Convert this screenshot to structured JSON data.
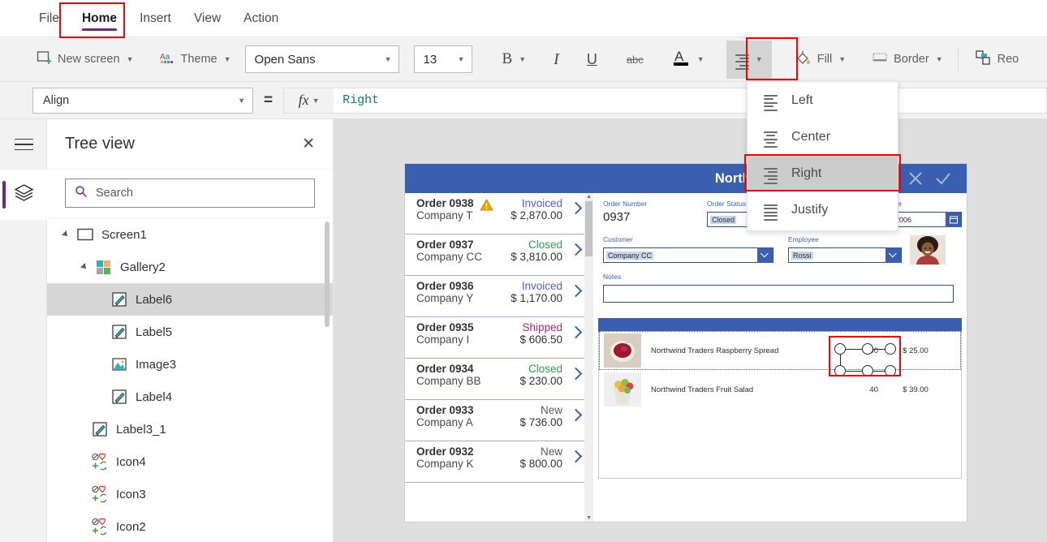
{
  "menubar": {
    "items": [
      {
        "label": "File",
        "active": false
      },
      {
        "label": "Home",
        "active": true
      },
      {
        "label": "Insert",
        "active": false
      },
      {
        "label": "View",
        "active": false
      },
      {
        "label": "Action",
        "active": false
      }
    ]
  },
  "ribbon": {
    "new_screen": "New screen",
    "theme": "Theme",
    "font_name": "Open Sans",
    "font_size": "13",
    "bold": "B",
    "italic": "I",
    "underline": "U",
    "strikethrough": "abc",
    "font_color": "A",
    "align": "align-icon",
    "fill": "Fill",
    "border": "Border",
    "reorder": "Reo"
  },
  "formula_bar": {
    "property": "Align",
    "equals": "=",
    "fx": "fx",
    "value": "Right"
  },
  "align_menu": {
    "items": [
      {
        "label": "Left",
        "selected": false
      },
      {
        "label": "Center",
        "selected": false
      },
      {
        "label": "Right",
        "selected": true
      },
      {
        "label": "Justify",
        "selected": false
      }
    ]
  },
  "tree_view": {
    "title": "Tree view",
    "close": "✕",
    "search_placeholder": "Search",
    "nodes": [
      {
        "label": "Screen1",
        "icon": "screen-icon",
        "indent": 0,
        "expander": true,
        "selected": false
      },
      {
        "label": "Gallery2",
        "icon": "gallery-icon",
        "indent": 1,
        "expander": true,
        "selected": false
      },
      {
        "label": "Label6",
        "icon": "label-icon",
        "indent": 2,
        "expander": false,
        "selected": true
      },
      {
        "label": "Label5",
        "icon": "label-icon",
        "indent": 2,
        "expander": false,
        "selected": false
      },
      {
        "label": "Image3",
        "icon": "image-icon",
        "indent": 2,
        "expander": false,
        "selected": false
      },
      {
        "label": "Label4",
        "icon": "label-icon",
        "indent": 2,
        "expander": false,
        "selected": false
      },
      {
        "label": "Label3_1",
        "icon": "label-icon",
        "indent": 1,
        "expander": false,
        "selected": false
      },
      {
        "label": "Icon4",
        "icon": "icon-icon",
        "indent": 1,
        "expander": false,
        "selected": false
      },
      {
        "label": "Icon3",
        "icon": "icon-icon",
        "indent": 1,
        "expander": false,
        "selected": false
      },
      {
        "label": "Icon2",
        "icon": "icon-icon",
        "indent": 1,
        "expander": false,
        "selected": false
      }
    ]
  },
  "app": {
    "gallery": {
      "rows": [
        {
          "order": "Order 0938",
          "company": "Company T",
          "status": "Invoiced",
          "status_color": "#5b5bd6",
          "amount": "$ 2,870.00",
          "warning": true
        },
        {
          "order": "Order 0937",
          "company": "Company CC",
          "status": "Closed",
          "status_color": "#2e9e4f",
          "amount": "$ 3,810.00",
          "warning": false
        },
        {
          "order": "Order 0936",
          "company": "Company Y",
          "status": "Invoiced",
          "status_color": "#5b5bd6",
          "amount": "$ 1,170.00",
          "warning": false
        },
        {
          "order": "Order 0935",
          "company": "Company I",
          "status": "Shipped",
          "status_color": "#b4247a",
          "amount": "$ 606.50",
          "warning": false
        },
        {
          "order": "Order 0934",
          "company": "Company BB",
          "status": "Closed",
          "status_color": "#2e9e4f",
          "amount": "$ 230.00",
          "warning": false
        },
        {
          "order": "Order 0933",
          "company": "Company A",
          "status": "New",
          "status_color": "#5a5a5a",
          "amount": "$ 736.00",
          "warning": false
        },
        {
          "order": "Order 0932",
          "company": "Company K",
          "status": "New",
          "status_color": "#5a5a5a",
          "amount": "$ 800.00",
          "warning": false
        }
      ]
    },
    "detail": {
      "title": "Northwind Orders",
      "cancel_icon": "close-icon",
      "confirm_icon": "check-icon",
      "fields": {
        "order_number_label": "Order Number",
        "order_number_value": "0937",
        "order_status_label": "Order Status",
        "order_status_value": "Closed",
        "order_date_label": "ate",
        "order_date_value": "2006",
        "customer_label": "Customer",
        "customer_value": "Company CC",
        "employee_label": "Employee",
        "employee_value": "Rossi",
        "notes_label": "Notes",
        "notes_value": ""
      },
      "products": [
        {
          "name": "Northwind Traders Raspberry Spread",
          "qty": "90",
          "price": "$ 25.00",
          "selected": true
        },
        {
          "name": "Northwind Traders Fruit Salad",
          "qty": "40",
          "price": "$ 39.00",
          "selected": false
        }
      ]
    }
  },
  "colors": {
    "accent_purple": "#742774",
    "app_blue": "#3b5fb0",
    "highlight_red": "#ff0000",
    "canvas_bg": "#dfdfdf"
  }
}
